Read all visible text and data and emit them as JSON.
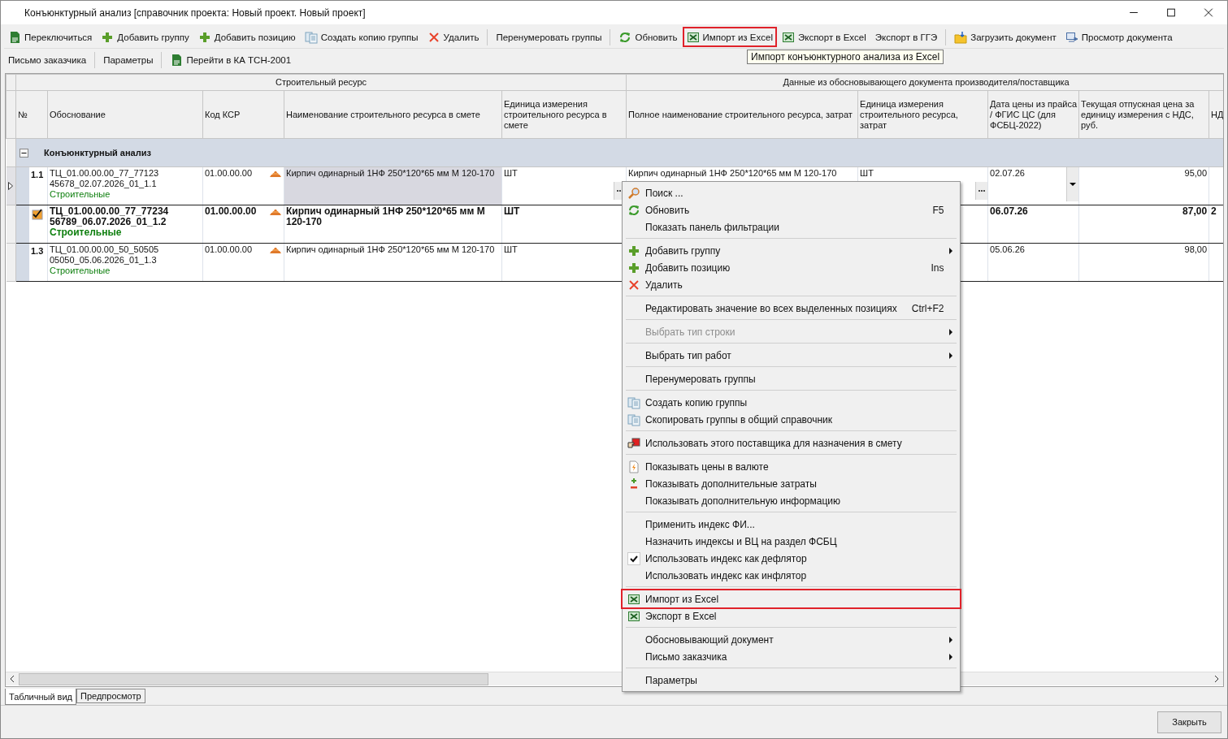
{
  "window": {
    "title": "Конъюнктурный анализ [справочник проекта: Новый проект. Новый проект]"
  },
  "toolbar_main": [
    {
      "kind": "button",
      "label": "Переключиться",
      "highlighted": false
    },
    {
      "kind": "button",
      "label": "Добавить группу",
      "highlighted": false
    },
    {
      "kind": "button",
      "label": "Добавить позицию",
      "highlighted": false
    },
    {
      "kind": "button",
      "label": "Создать копию группы",
      "highlighted": false
    },
    {
      "kind": "button",
      "label": "Удалить",
      "highlighted": false
    },
    {
      "kind": "separator"
    },
    {
      "kind": "button",
      "label": "Перенумеровать группы",
      "highlighted": false
    },
    {
      "kind": "separator"
    },
    {
      "kind": "button",
      "label": "Обновить",
      "highlighted": false
    },
    {
      "kind": "button",
      "label": "Импорт из Excel",
      "highlighted": true
    },
    {
      "kind": "button",
      "label": "Экспорт в Excel",
      "highlighted": false
    },
    {
      "kind": "button",
      "label": "Экспорт в ГГЭ",
      "highlighted": false
    },
    {
      "kind": "separator"
    },
    {
      "kind": "button",
      "label": "Загрузить документ",
      "highlighted": false
    },
    {
      "kind": "button",
      "label": "Просмотр документа",
      "highlighted": false
    }
  ],
  "toolbar_second": [
    {
      "kind": "button",
      "label": "Письмо заказчика",
      "highlighted": false
    },
    {
      "kind": "separator"
    },
    {
      "kind": "button",
      "label": "Параметры",
      "highlighted": false
    },
    {
      "kind": "separator"
    },
    {
      "kind": "button",
      "label": "Перейти в КА ТСН-2001",
      "highlighted": false
    }
  ],
  "tooltip": "Импорт конъюнктурного анализа из Excel",
  "table": {
    "groups": [
      "Строительный ресурс",
      "Данные из обосновывающего документа производителя/поставщика"
    ],
    "columns": [
      "№",
      "Обоснование",
      "Код КСР",
      "Наименование строительного ресурса в смете",
      "Единица измерения строительного ресурса в смете",
      "Полное наименование строительного ресурса, затрат",
      "Единица измерения строительного ресурса, затрат",
      "Дата цены из прайса / ФГИС ЦС (для ФСБЦ-2022)",
      "Текущая отпускная цена за единицу измерения с НДС, руб.",
      "НД"
    ],
    "group_row": {
      "label": "Конъюнктурный анализ",
      "expanded": true
    },
    "rows": [
      {
        "number": "1.1",
        "flagged": false,
        "selected": true,
        "bold": false,
        "name_focused": true,
        "basis": "ТЦ_01.00.00.00_77_77123 45678_02.07.2026_01_1.1",
        "category": "Строительные",
        "code": "01.00.00.00",
        "name": "Кирпич одинарный 1НФ 250*120*65 мм М 120-170",
        "unit": "ШТ",
        "full_name": "Кирпич одинарный 1НФ 250*120*65 мм М 120-170",
        "full_unit": "ШТ",
        "date": "02.07.26",
        "price": "95,00"
      },
      {
        "flagged": true,
        "selected": false,
        "bold": true,
        "name_focused": false,
        "basis": "ТЦ_01.00.00.00_77_77234 56789_06.07.2026_01_1.2",
        "category": "Строительные",
        "code": "01.00.00.00",
        "name": "Кирпич одинарный 1НФ 250*120*65 мм М 120-170",
        "unit": "ШТ",
        "date": "06.07.26",
        "price": "87,00",
        "nd": "2"
      },
      {
        "number": "1.3",
        "flagged": false,
        "selected": false,
        "bold": false,
        "name_focused": false,
        "basis": "ТЦ_01.00.00.00_50_50505 05050_05.06.2026_01_1.3",
        "category": "Строительные",
        "code": "01.00.00.00",
        "name": "Кирпич одинарный 1НФ 250*120*65 мм М 120-170",
        "unit": "ШТ",
        "date": "05.06.26",
        "price": "98,00"
      }
    ]
  },
  "context_menu": [
    {
      "kind": "item",
      "label": "Поиск ...",
      "disabled": false,
      "highlighted": false
    },
    {
      "kind": "item",
      "label": "Обновить",
      "shortcut": "F5",
      "disabled": false,
      "highlighted": false
    },
    {
      "kind": "item",
      "label": "Показать панель фильтрации",
      "disabled": false,
      "highlighted": false
    },
    {
      "kind": "separator"
    },
    {
      "kind": "item",
      "label": "Добавить группу",
      "submenu": true,
      "disabled": false,
      "highlighted": false
    },
    {
      "kind": "item",
      "label": "Добавить позицию",
      "shortcut": "Ins",
      "disabled": false,
      "highlighted": false
    },
    {
      "kind": "item",
      "label": "Удалить",
      "disabled": false,
      "highlighted": false
    },
    {
      "kind": "separator"
    },
    {
      "kind": "item",
      "label": "Редактировать значение во всех выделенных позициях",
      "shortcut": "Ctrl+F2",
      "disabled": false,
      "highlighted": false
    },
    {
      "kind": "separator"
    },
    {
      "kind": "item",
      "label": "Выбрать тип строки",
      "submenu": true,
      "disabled": true,
      "highlighted": false
    },
    {
      "kind": "separator"
    },
    {
      "kind": "item",
      "label": "Выбрать тип работ",
      "submenu": true,
      "disabled": false,
      "highlighted": false
    },
    {
      "kind": "separator"
    },
    {
      "kind": "item",
      "label": "Перенумеровать группы",
      "disabled": false,
      "highlighted": false
    },
    {
      "kind": "separator"
    },
    {
      "kind": "item",
      "label": "Создать копию группы",
      "disabled": false,
      "highlighted": false
    },
    {
      "kind": "item",
      "label": "Скопировать группы в общий справочник",
      "disabled": false,
      "highlighted": false
    },
    {
      "kind": "separator"
    },
    {
      "kind": "item",
      "label": "Использовать этого поставщика для назначения в смету",
      "disabled": false,
      "highlighted": false
    },
    {
      "kind": "separator"
    },
    {
      "kind": "item",
      "label": "Показывать цены в валюте",
      "disabled": false,
      "highlighted": false
    },
    {
      "kind": "item",
      "label": "Показывать дополнительные затраты",
      "disabled": false,
      "highlighted": false
    },
    {
      "kind": "item",
      "label": "Показывать дополнительную информацию",
      "disabled": false,
      "highlighted": false
    },
    {
      "kind": "separator"
    },
    {
      "kind": "item",
      "label": "Применить индекс ФИ...",
      "disabled": false,
      "highlighted": false
    },
    {
      "kind": "item",
      "label": "Назначить индексы и ВЦ на раздел ФСБЦ",
      "disabled": false,
      "highlighted": false
    },
    {
      "kind": "check",
      "label": "Использовать индекс как дефлятор",
      "checked": true,
      "disabled": false,
      "highlighted": false
    },
    {
      "kind": "check",
      "label": "Использовать индекс как инфлятор",
      "checked": false,
      "disabled": false,
      "highlighted": false
    },
    {
      "kind": "separator"
    },
    {
      "kind": "item",
      "label": "Импорт из Excel",
      "disabled": false,
      "highlighted": true
    },
    {
      "kind": "item",
      "label": "Экспорт в Excel",
      "disabled": false,
      "highlighted": false
    },
    {
      "kind": "separator"
    },
    {
      "kind": "item",
      "label": "Обосновывающий документ",
      "submenu": true,
      "disabled": false,
      "highlighted": false
    },
    {
      "kind": "item",
      "label": "Письмо заказчика",
      "submenu": true,
      "disabled": false,
      "highlighted": false
    },
    {
      "kind": "separator"
    },
    {
      "kind": "item",
      "label": "Параметры",
      "disabled": false,
      "highlighted": false
    }
  ],
  "view_tabs": [
    {
      "label": "Табличный вид",
      "selected": true
    },
    {
      "label": "Предпросмотр",
      "selected": false
    }
  ],
  "close_button": "Закрыть"
}
